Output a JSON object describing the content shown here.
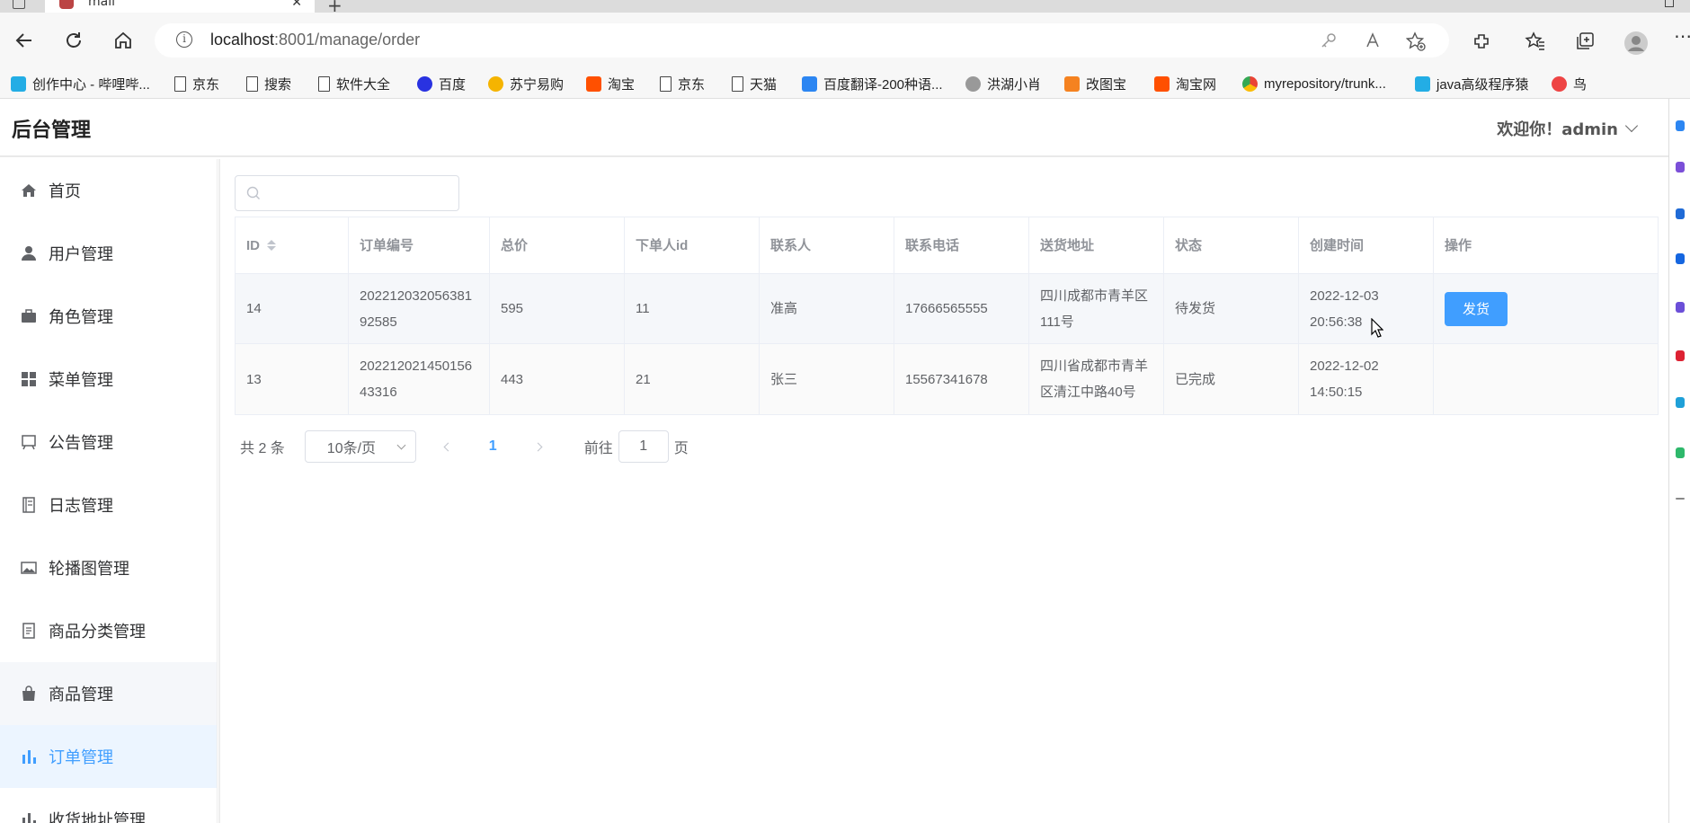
{
  "browser": {
    "tab_title": "mall",
    "url_host": "localhost",
    "url_rest": ":8001/manage/order",
    "bookmarks": [
      {
        "label": "创作中心 - 哔哩哔...",
        "icon": "bilibili-icon",
        "color": "#23ade5"
      },
      {
        "label": "京东",
        "icon": "page-icon"
      },
      {
        "label": "搜索",
        "icon": "page-icon"
      },
      {
        "label": "软件大全",
        "icon": "page-icon"
      },
      {
        "label": "百度",
        "icon": "baidu-icon",
        "color": "#2932e1"
      },
      {
        "label": "苏宁易购",
        "icon": "suning-icon",
        "color": "#f5b400"
      },
      {
        "label": "淘宝",
        "icon": "taobao-icon",
        "color": "#ff5000"
      },
      {
        "label": "京东",
        "icon": "page-icon"
      },
      {
        "label": "天猫",
        "icon": "page-icon"
      },
      {
        "label": "百度翻译-200种语...",
        "icon": "translate-icon",
        "color": "#2c86f2"
      },
      {
        "label": "洪湖小肖",
        "icon": "bird-icon",
        "color": "#888"
      },
      {
        "label": "改图宝",
        "icon": "gaitubao-icon",
        "color": "#f58220"
      },
      {
        "label": "淘宝网",
        "icon": "taobao-icon",
        "color": "#ff5000"
      },
      {
        "label": "myrepository/trunk...",
        "icon": "chrome-icon",
        "color": "#4285f4"
      },
      {
        "label": "java高级程序猿",
        "icon": "bilibili-icon",
        "color": "#23ade5"
      },
      {
        "label": "鸟",
        "icon": "bird-icon",
        "color": "#e44"
      }
    ]
  },
  "header": {
    "title": "后台管理",
    "welcome": "欢迎你！admin"
  },
  "sidebar": {
    "items": [
      {
        "label": "首页",
        "icon": "home-icon"
      },
      {
        "label": "用户管理",
        "icon": "user-icon"
      },
      {
        "label": "角色管理",
        "icon": "briefcase-icon"
      },
      {
        "label": "菜单管理",
        "icon": "grid-icon"
      },
      {
        "label": "公告管理",
        "icon": "board-icon"
      },
      {
        "label": "日志管理",
        "icon": "notebook-icon"
      },
      {
        "label": "轮播图管理",
        "icon": "picture-icon"
      },
      {
        "label": "商品分类管理",
        "icon": "document-icon"
      },
      {
        "label": "商品管理",
        "icon": "bag-icon"
      },
      {
        "label": "订单管理",
        "icon": "chart-icon"
      },
      {
        "label": "收货地址管理",
        "icon": "chart-icon"
      }
    ],
    "active_index": 9
  },
  "search": {
    "placeholder": ""
  },
  "table": {
    "columns": [
      "ID",
      "订单编号",
      "总价",
      "下单人id",
      "联系人",
      "联系电话",
      "送货地址",
      "状态",
      "创建时间",
      "操作"
    ],
    "rows": [
      {
        "id": "14",
        "order_no": "20221203205638192585",
        "total": "595",
        "user_id": "11",
        "contact": "准高",
        "phone": "17666565555",
        "address": "四川成都市青羊区111号",
        "status": "待发货",
        "created": "2022-12-03 20:56:38",
        "action": "发货"
      },
      {
        "id": "13",
        "order_no": "20221202145015643316",
        "total": "443",
        "user_id": "21",
        "contact": "张三",
        "phone": "15567341678",
        "address": "四川省成都市青羊区清江中路40号",
        "status": "已完成",
        "created": "2022-12-02 14:50:15",
        "action": ""
      }
    ]
  },
  "pagination": {
    "total_text": "共 2 条",
    "page_size": "10条/页",
    "current_page": "1",
    "goto_label": "前往",
    "goto_value": "1",
    "page_suffix": "页"
  },
  "colors": {
    "primary": "#409eff",
    "active_bg": "#ecf5ff"
  }
}
